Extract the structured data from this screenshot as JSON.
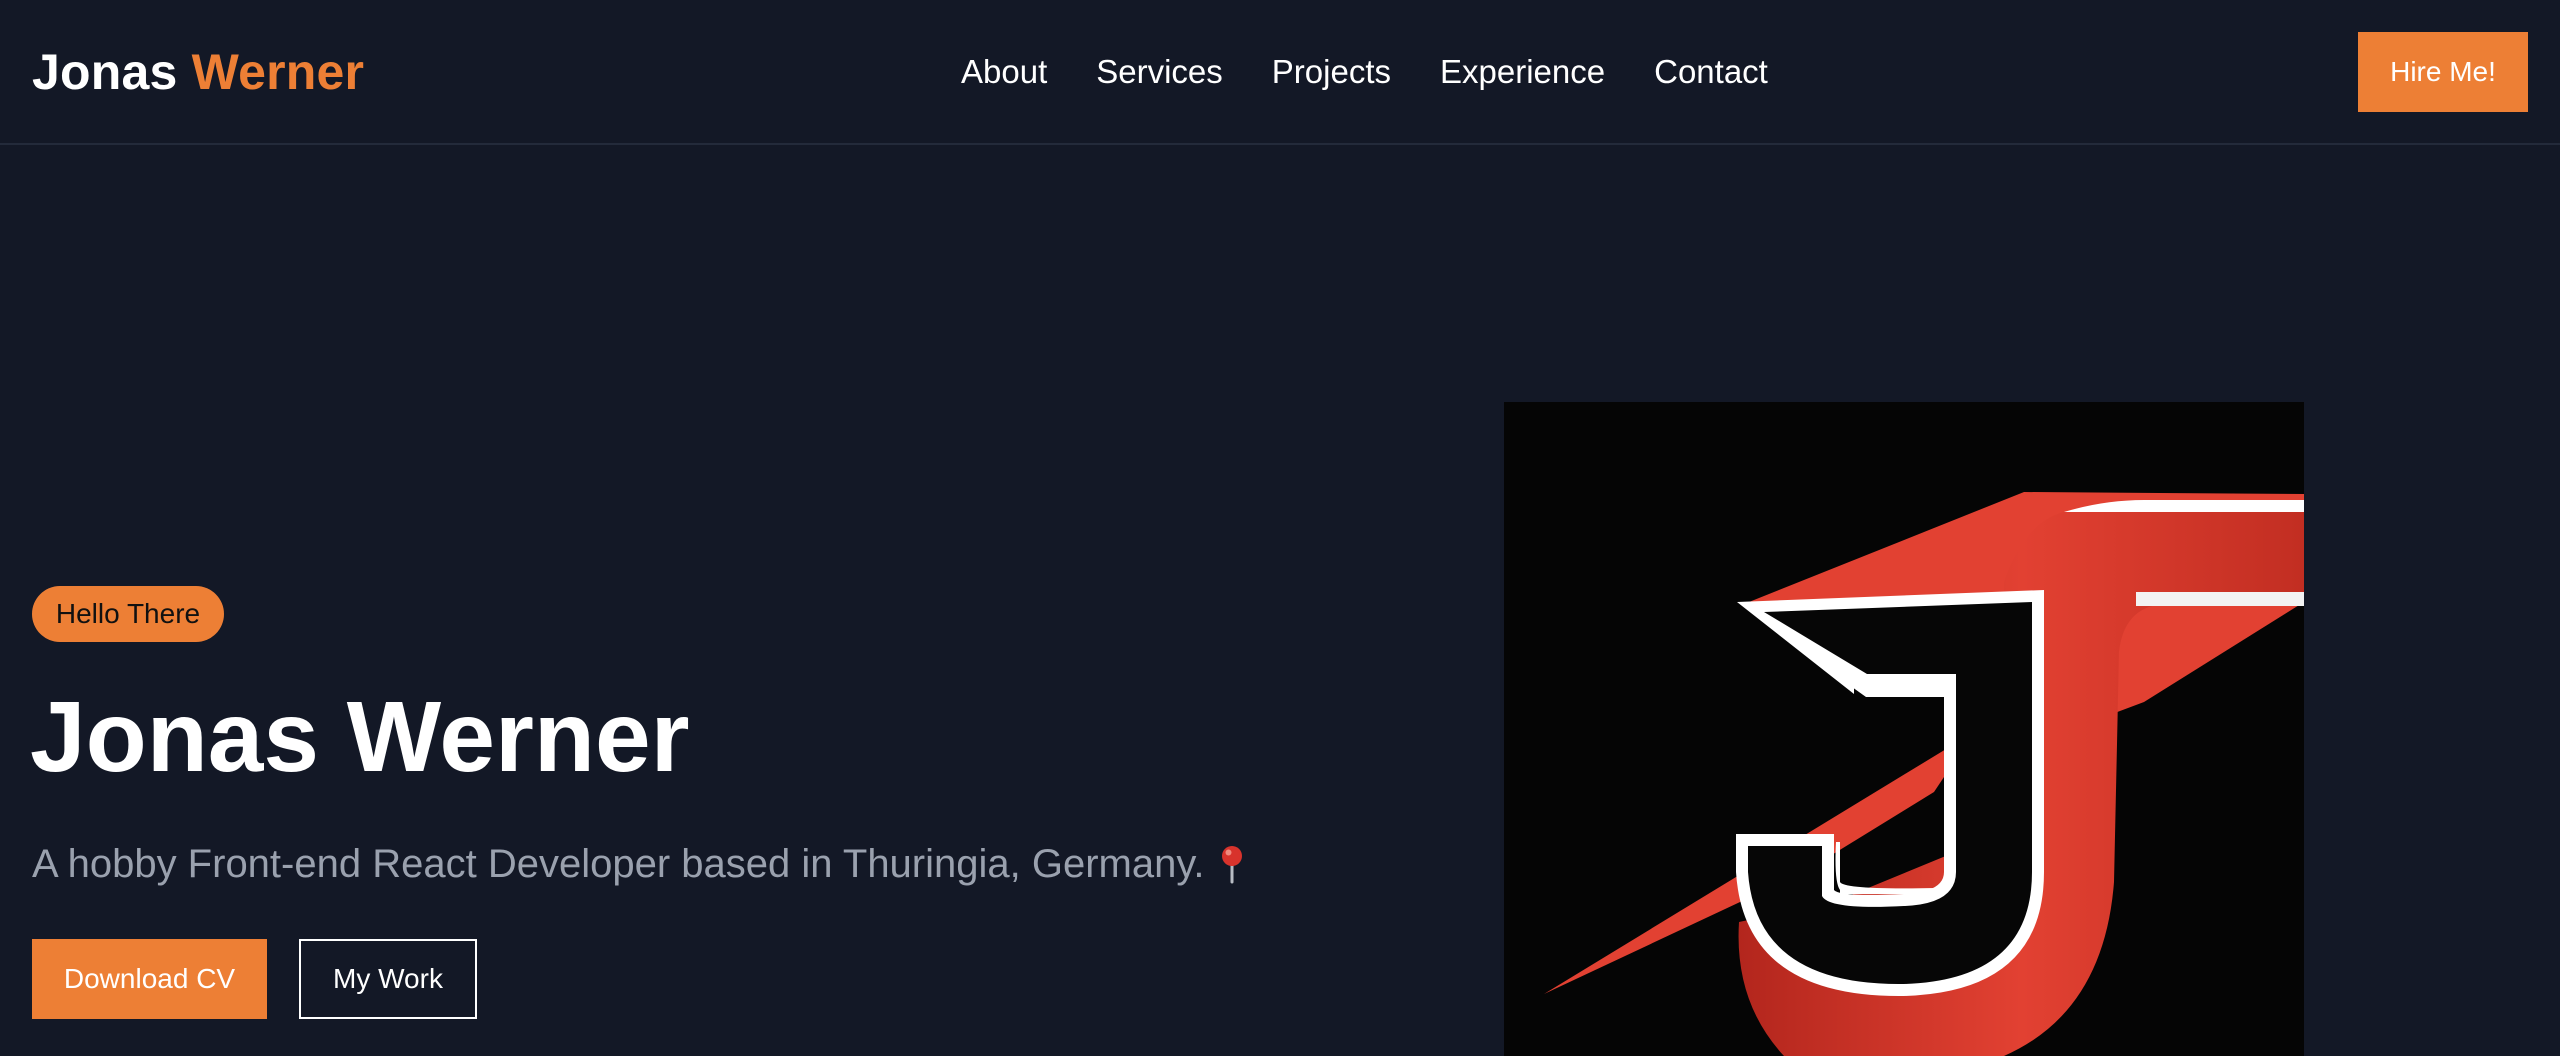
{
  "header": {
    "brand": {
      "first": "Jonas",
      "last": "Werner"
    },
    "nav": [
      {
        "label": "About"
      },
      {
        "label": "Services"
      },
      {
        "label": "Projects"
      },
      {
        "label": "Experience"
      },
      {
        "label": "Contact"
      }
    ],
    "cta_label": "Hire Me!"
  },
  "hero": {
    "badge": "Hello There",
    "title": "Jonas Werner",
    "subtitle": "A hobby Front-end React Developer based in Thuringia, Germany.",
    "subtitle_icon": "round-pushpin-icon",
    "buttons": {
      "primary": "Download CV",
      "secondary": "My Work"
    },
    "image_icon": "jw-monogram-logo"
  },
  "colors": {
    "background": "#131826",
    "accent": "#ed7f35",
    "muted_text": "#9aa1ae",
    "logo_red": "#e24132"
  }
}
